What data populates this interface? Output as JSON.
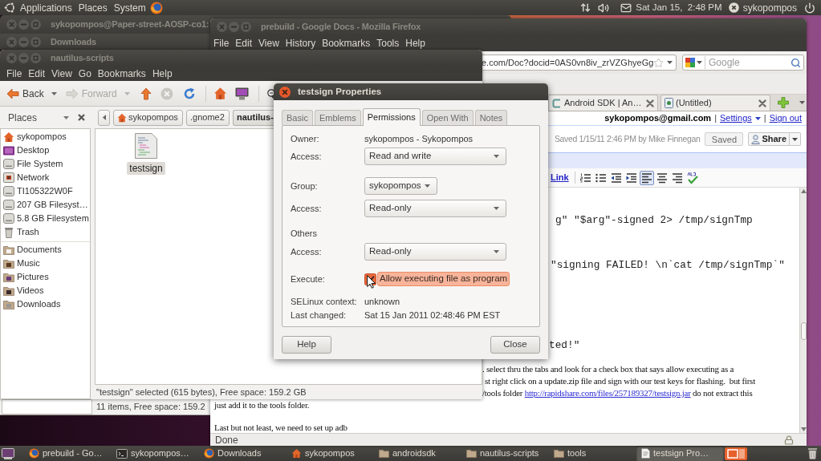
{
  "top_panel": {
    "menus": [
      "Applications",
      "Places",
      "System"
    ],
    "clock": "Sat Jan 15,  2:48 PM",
    "user": "sykopompos"
  },
  "terminal_window": {
    "title": "sykopompos@Paper-street-AOSP-co1:"
  },
  "downloads_window": {
    "title": "Downloads",
    "status": "11 items, Free space: 159.2"
  },
  "firefox": {
    "title": "prebuild - Google Docs - Mozilla Firefox",
    "menus": [
      "File",
      "Edit",
      "View",
      "History",
      "Bookmarks",
      "Tools",
      "Help"
    ],
    "url": "e.com/Doc?docid=0AS0vn8iv_zrVZGhyeGg",
    "search": {
      "placeholder": "Google"
    },
    "tabs": [
      {
        "label": "Android SDK | An…",
        "selected": false
      },
      {
        "label": "(Untitled)",
        "selected": false
      }
    ],
    "account_bar": [
      {
        "kind": "email",
        "text": "sykopompos@gmail.com"
      },
      {
        "kind": "separator",
        "text": "|"
      },
      {
        "kind": "menu_link",
        "text": "Settings"
      },
      {
        "kind": "separator",
        "text": "|"
      },
      {
        "kind": "link",
        "text": "Sign out"
      }
    ],
    "save_status": "Saved 1/15/11 2:46 PM by Mike Finnegan",
    "doc_buttons": [
      {
        "kind": "plain",
        "label": "Saved"
      },
      {
        "kind": "share",
        "label": "Share"
      }
    ],
    "editor_toolbar": {
      "link": "Link",
      "buttons": [
        {
          "kind": "numbered_list",
          "selected": false
        },
        {
          "kind": "bullet_list",
          "selected": false
        },
        {
          "kind": "outdent",
          "selected": false
        },
        {
          "kind": "indent",
          "selected": false
        },
        {
          "kind": "align_left",
          "selected": true
        },
        {
          "kind": "align_center",
          "selected": false
        },
        {
          "kind": "align_right",
          "selected": false
        },
        {
          "kind": "spellcheck",
          "selected": false
        }
      ]
    },
    "document": [
      {
        "kind": "code",
        "segments": [
          {
            "text": "g\" \"$arg\"-signed 2> /tmp/signTmp",
            "link": false
          }
        ]
      },
      {
        "kind": "code",
        "segments": [
          {
            "text": "\"signing FAILED! \\n`cat /tmp/signTmp`\"",
            "link": false
          }
        ]
      },
      {
        "kind": "code",
        "segments": [
          {
            "text": "ted!\"",
            "link": false
          }
        ]
      },
      {
        "kind": "prose",
        "segments": [
          {
            "text": ". select thru the tabs and look for a check box that says allow executing as a",
            "link": false
          }
        ]
      },
      {
        "kind": "prose",
        "segments": [
          {
            "text": "st right click on a update.zip file and sign with our test keys for flashing.  but first",
            "link": false
          }
        ]
      },
      {
        "kind": "prose",
        "segments": [
          {
            "text": "/tools folder",
            "link": false
          },
          {
            "text": "http://rapidshare.com/files/257189327/testsign.jar",
            "link": true
          },
          {
            "text": "do not extract this",
            "link": false
          }
        ]
      },
      {
        "kind": "prose",
        "segments": [
          {
            "text": "just add it to the tools folder.",
            "link": false
          }
        ]
      },
      {
        "kind": "prose",
        "segments": [
          {
            "text": "Last but not least, we need to set up adb",
            "link": false
          }
        ]
      }
    ],
    "status": "Done"
  },
  "nautilus": {
    "title": "nautilus-scripts",
    "menus": [
      "File",
      "Edit",
      "View",
      "Go",
      "Bookmarks",
      "Help"
    ],
    "nav_buttons": [
      {
        "label": "Back",
        "disabled": false
      },
      {
        "label": "Forward",
        "disabled": true
      }
    ],
    "sidebar": {
      "title": "Places",
      "groups": [
        {
          "items": [
            {
              "kind": "home",
              "label": "sykopompos"
            },
            {
              "kind": "desktop",
              "label": "Desktop"
            },
            {
              "kind": "drive",
              "label": "File System"
            },
            {
              "kind": "network",
              "label": "Network"
            },
            {
              "kind": "drive",
              "label": "TI105322W0F"
            },
            {
              "kind": "drive",
              "label": "207 GB Filesyst…"
            },
            {
              "kind": "drive",
              "label": "5.8 GB Filesystem"
            },
            {
              "kind": "trash",
              "label": "Trash"
            }
          ]
        },
        {
          "items": [
            {
              "kind": "documents",
              "label": "Documents"
            },
            {
              "kind": "music",
              "label": "Music"
            },
            {
              "kind": "pictures",
              "label": "Pictures"
            },
            {
              "kind": "videos",
              "label": "Videos"
            },
            {
              "kind": "downloads",
              "label": "Downloads"
            }
          ]
        }
      ]
    },
    "path": [
      {
        "kind": "home",
        "label": "sykopompos",
        "selected": false
      },
      {
        "kind": "folder",
        "label": ".gnome2",
        "selected": false
      },
      {
        "kind": "folder",
        "label": "nautilus-",
        "selected": true
      }
    ],
    "files": [
      {
        "name": "testsign",
        "selected": true
      }
    ],
    "status": "\"testsign\" selected (615 bytes), Free space: 159.2 GB"
  },
  "dialog": {
    "title": "testsign Properties",
    "tabs": [
      {
        "label": "Basic",
        "selected": false
      },
      {
        "label": "Emblems",
        "selected": false
      },
      {
        "label": "Permissions",
        "selected": true
      },
      {
        "label": "Open With",
        "selected": false
      },
      {
        "label": "Notes",
        "selected": false
      }
    ],
    "rows": [
      {
        "kind": "text",
        "label": "Owner:",
        "value": "sykopompos - Sykopompos"
      },
      {
        "kind": "dropdown",
        "label": "Access:",
        "value": "Read and write"
      },
      {
        "kind": "combo",
        "label": "Group:",
        "value": "sykopompos"
      },
      {
        "kind": "dropdown",
        "label": "Access:",
        "value": "Read-only"
      },
      {
        "kind": "heading",
        "label": "Others"
      },
      {
        "kind": "dropdown",
        "label": "Access:",
        "value": "Read-only"
      },
      {
        "kind": "checkbox",
        "label": "Execute:",
        "value": "Allow executing file as program",
        "checked": true,
        "hovered": true
      },
      {
        "kind": "text",
        "label": "SELinux context:",
        "value": "unknown"
      },
      {
        "kind": "text",
        "label": "Last changed:",
        "value": "Sat 15 Jan 2011 02:48:46 PM EST"
      }
    ],
    "buttons": [
      "Help",
      "Close"
    ]
  },
  "taskbar": [
    {
      "kind": "browser",
      "label": "prebuild - Go…",
      "selected": false
    },
    {
      "kind": "terminal",
      "label": "sykopompos…",
      "selected": false
    },
    {
      "kind": "browser",
      "label": "Downloads",
      "selected": false
    },
    {
      "kind": "home",
      "label": "sykopompos",
      "selected": false
    },
    {
      "kind": "folder",
      "label": "androidsdk",
      "selected": false
    },
    {
      "kind": "folder",
      "label": "nautilus-scripts",
      "selected": false
    },
    {
      "kind": "folder",
      "label": "tools",
      "selected": false
    },
    {
      "kind": "document",
      "label": "testsign Pro…",
      "selected": true
    }
  ]
}
